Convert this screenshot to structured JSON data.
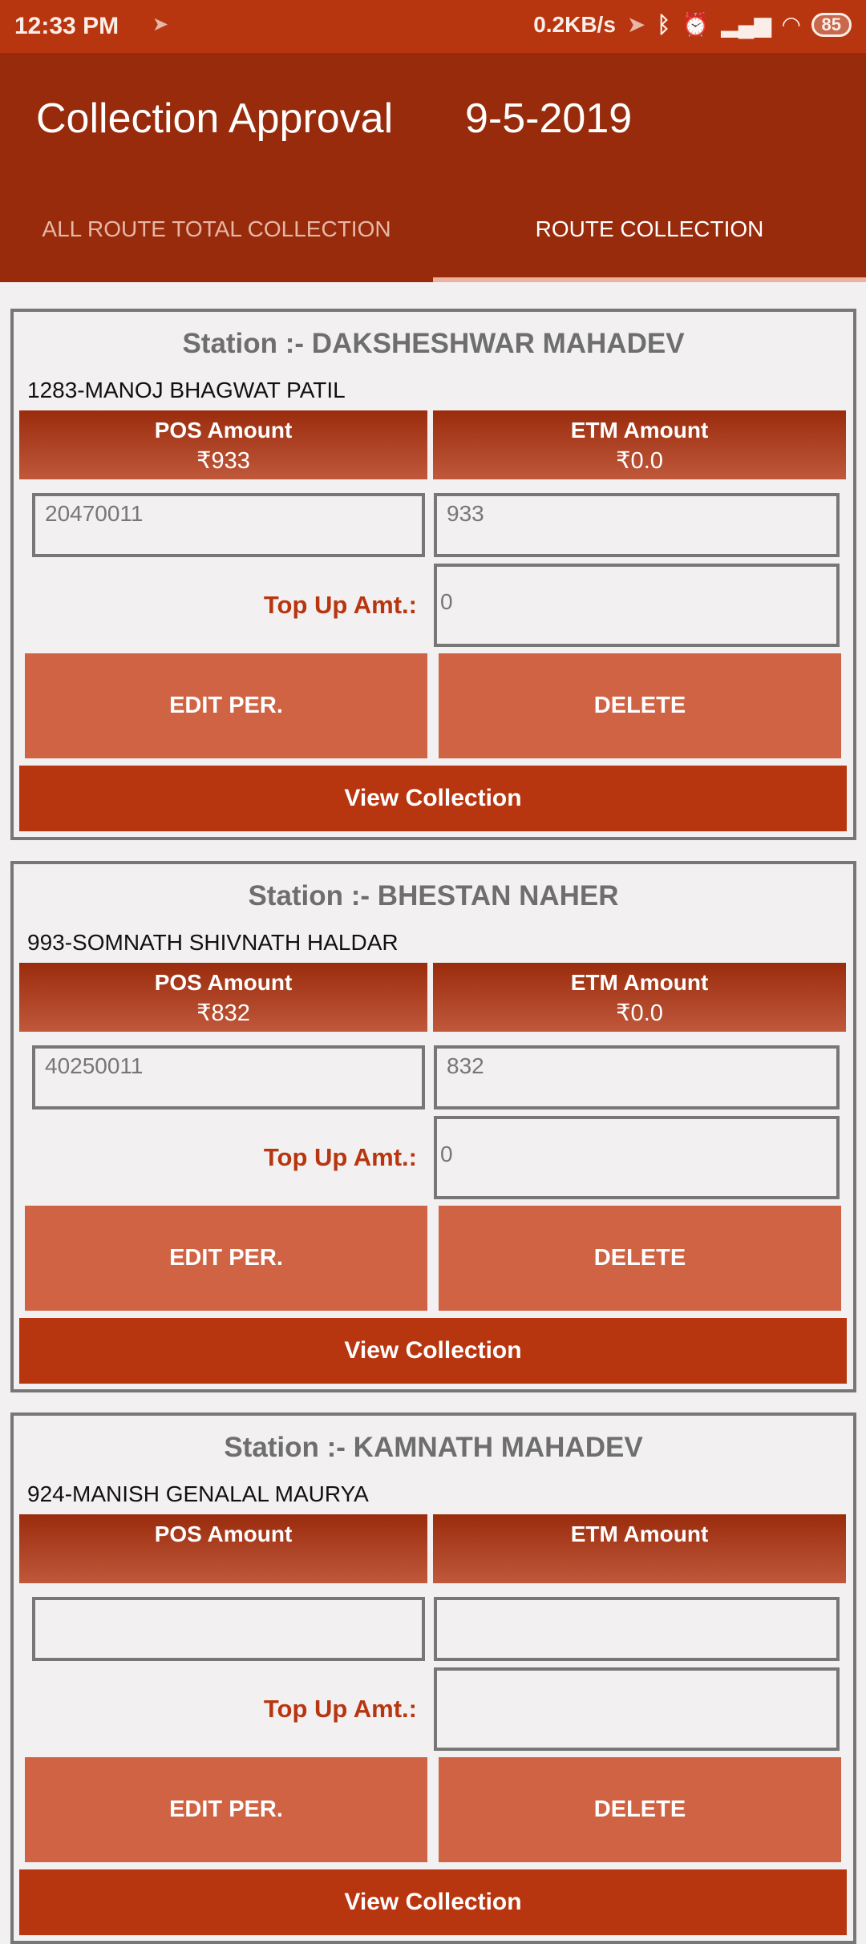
{
  "status_bar": {
    "time": "12:33 PM",
    "speed": "0.2KB/s",
    "battery": "85"
  },
  "header": {
    "title": "Collection Approval",
    "date": "9-5-2019"
  },
  "tabs": [
    {
      "label": "ALL ROUTE TOTAL COLLECTION",
      "active": false
    },
    {
      "label": "ROUTE COLLECTION",
      "active": true
    }
  ],
  "labels": {
    "pos": "POS Amount",
    "etm": "ETM Amount",
    "topup": "Top Up Amt.:",
    "edit": "EDIT PER.",
    "delete": "DELETE",
    "view": "View Collection"
  },
  "cards": [
    {
      "station": "Station :- DAKSHESHWAR MAHADEV",
      "name": "1283-MANOJ BHAGWAT PATIL",
      "pos_amount": "₹933",
      "etm_amount": "₹0.0",
      "field1": "20470011",
      "field2": "933",
      "topup": "0"
    },
    {
      "station": "Station :- BHESTAN NAHER",
      "name": "993-SOMNATH SHIVNATH HALDAR",
      "pos_amount": "₹832",
      "etm_amount": "₹0.0",
      "field1": "40250011",
      "field2": "832",
      "topup": "0"
    },
    {
      "station": "Station :- KAMNATH MAHADEV",
      "name": "924-MANISH  GENALAL MAURYA",
      "pos_amount": "",
      "etm_amount": "",
      "field1": "",
      "field2": "",
      "topup": ""
    }
  ]
}
